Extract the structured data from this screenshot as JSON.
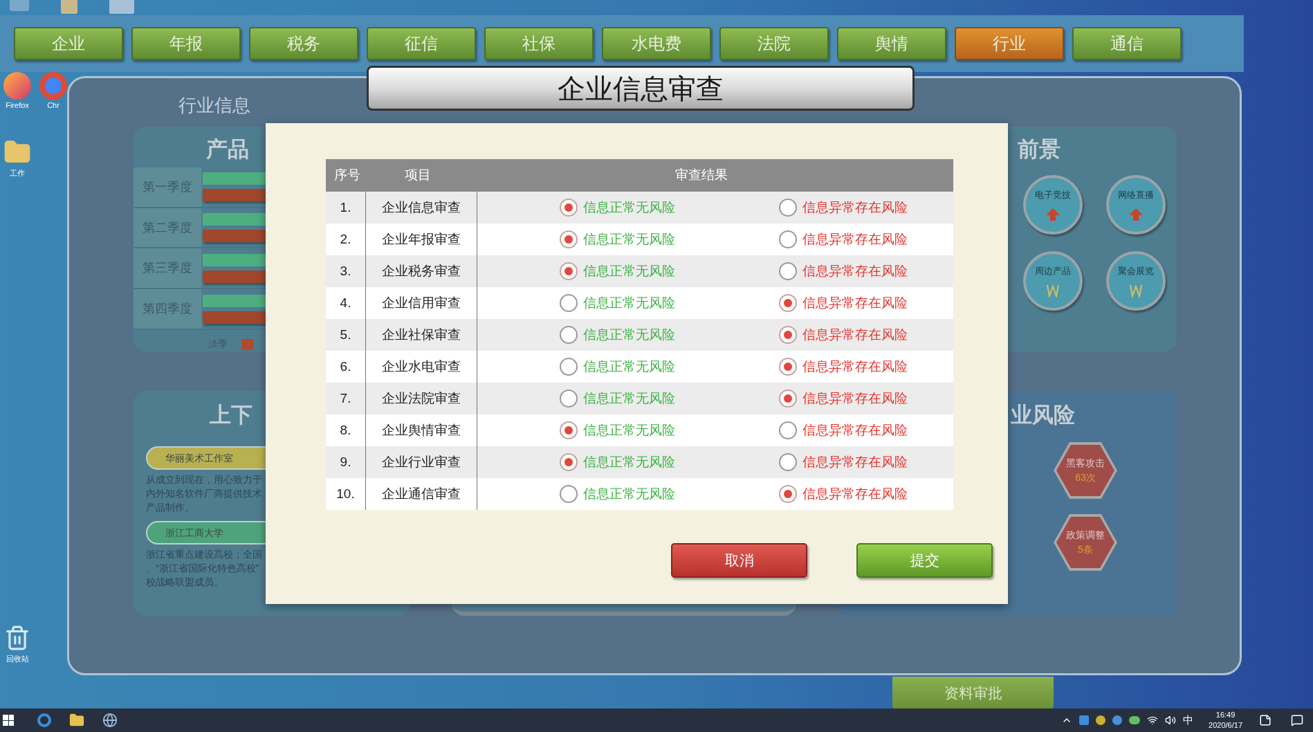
{
  "desktop_icons": [
    {
      "label": "Firefox",
      "kind": "firefox"
    },
    {
      "label": "Chr",
      "kind": "chrome"
    },
    {
      "label": "工作",
      "kind": "folder"
    },
    {
      "label": "回收站",
      "kind": "bin"
    }
  ],
  "nav_tabs": [
    {
      "label": "企业",
      "selected": false
    },
    {
      "label": "年报",
      "selected": false
    },
    {
      "label": "税务",
      "selected": false
    },
    {
      "label": "征信",
      "selected": false
    },
    {
      "label": "社保",
      "selected": false
    },
    {
      "label": "水电费",
      "selected": false
    },
    {
      "label": "法院",
      "selected": false
    },
    {
      "label": "舆情",
      "selected": false
    },
    {
      "label": "行业",
      "selected": true
    },
    {
      "label": "通信",
      "selected": false
    }
  ],
  "panel_title": "行业信息",
  "product_panel": {
    "title": "产品",
    "quarters": [
      "第一季度",
      "第二季度",
      "第三季度",
      "第四季度"
    ],
    "legend": "淡季"
  },
  "chain_panel": {
    "title": "上下",
    "entries": [
      {
        "name": "华丽美术工作室",
        "color": "#b9b052",
        "lines": [
          "从成立到现在，用心致力于",
          "内外知名软件厂商提供技术",
          "产品制作。"
        ]
      },
      {
        "name": "浙江工商大学",
        "color": "#4fa37c",
        "lines": [
          "浙江省重点建设高校；全国",
          "、“浙江省国际化特色高校”",
          "校战略联盟成员。"
        ]
      }
    ]
  },
  "outlook_panel": {
    "title": "前景",
    "items": [
      {
        "label": "电子竞技",
        "kind": "up"
      },
      {
        "label": "网络直播",
        "kind": "up"
      },
      {
        "label": "周边产品",
        "kind": "zigzag"
      },
      {
        "label": "聚会展览",
        "kind": "zigzag"
      }
    ]
  },
  "risk_panel": {
    "title": "业风险",
    "items": [
      {
        "label": "黑客攻击",
        "count": "63次"
      },
      {
        "label": "政策调整",
        "count": "5条"
      }
    ]
  },
  "dialog": {
    "title": "企业信息审查",
    "columns": [
      "序号",
      "项目",
      "审查结果"
    ],
    "rows": [
      {
        "no": "1.",
        "item": "企业信息审查",
        "options": [
          {
            "label": "信息正常无风险",
            "color": "#3cb043",
            "selected": true
          },
          {
            "label": "信息异常存在风险",
            "color": "#e8322c",
            "selected": false
          }
        ]
      },
      {
        "no": "2.",
        "item": "企业年报审查",
        "options": [
          {
            "label": "信息正常无风险",
            "color": "#3cb043",
            "selected": true
          },
          {
            "label": "信息异常存在风险",
            "color": "#e8322c",
            "selected": false
          }
        ]
      },
      {
        "no": "3.",
        "item": "企业税务审查",
        "options": [
          {
            "label": "信息正常无风险",
            "color": "#3cb043",
            "selected": true
          },
          {
            "label": "信息异常存在风险",
            "color": "#e8322c",
            "selected": false
          }
        ]
      },
      {
        "no": "4.",
        "item": "企业信用审查",
        "options": [
          {
            "label": "信息正常无风险",
            "color": "#3cb043",
            "selected": false
          },
          {
            "label": "信息异常存在风险",
            "color": "#e8322c",
            "selected": true
          }
        ]
      },
      {
        "no": "5.",
        "item": "企业社保审查",
        "options": [
          {
            "label": "信息正常无风险",
            "color": "#3cb043",
            "selected": false
          },
          {
            "label": "信息异常存在风险",
            "color": "#e8322c",
            "selected": true
          }
        ]
      },
      {
        "no": "6.",
        "item": "企业水电审查",
        "options": [
          {
            "label": "信息正常无风险",
            "color": "#3cb043",
            "selected": false
          },
          {
            "label": "信息异常存在风险",
            "color": "#e8322c",
            "selected": true
          }
        ]
      },
      {
        "no": "7.",
        "item": "企业法院审查",
        "options": [
          {
            "label": "信息正常无风险",
            "color": "#3cb043",
            "selected": false
          },
          {
            "label": "信息异常存在风险",
            "color": "#e8322c",
            "selected": true
          }
        ]
      },
      {
        "no": "8.",
        "item": "企业舆情审查",
        "options": [
          {
            "label": "信息正常无风险",
            "color": "#3cb043",
            "selected": true
          },
          {
            "label": "信息异常存在风险",
            "color": "#e8322c",
            "selected": false
          }
        ]
      },
      {
        "no": "9.",
        "item": "企业行业审查",
        "options": [
          {
            "label": "信息正常无风险",
            "color": "#3cb043",
            "selected": true
          },
          {
            "label": "信息异常存在风险",
            "color": "#e8322c",
            "selected": false
          }
        ]
      },
      {
        "no": "10.",
        "item": "企业通信审查",
        "options": [
          {
            "label": "信息正常无风险",
            "color": "#3cb043",
            "selected": false
          },
          {
            "label": "信息异常存在风险",
            "color": "#e8322c",
            "selected": true
          }
        ]
      }
    ],
    "buttons": [
      {
        "label": "取消",
        "kind": "cancel"
      },
      {
        "label": "提交",
        "kind": "submit"
      }
    ]
  },
  "approve_button": "资料审批",
  "taskbar": {
    "ime": "中",
    "time": "16:49",
    "date": "2020/6/17"
  }
}
